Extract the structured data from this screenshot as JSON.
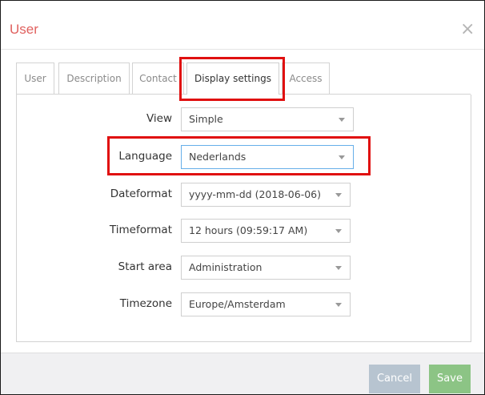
{
  "dialog": {
    "title": "User",
    "close_glyph": "×"
  },
  "tabs": [
    {
      "label": "User",
      "active": false
    },
    {
      "label": "Description",
      "active": false
    },
    {
      "label": "Contact",
      "active": false
    },
    {
      "label": "Display settings",
      "active": true
    },
    {
      "label": "Access",
      "active": false
    }
  ],
  "form": {
    "view": {
      "label": "View",
      "value": "Simple"
    },
    "language": {
      "label": "Language",
      "value": "Nederlands"
    },
    "dateformat": {
      "label": "Dateformat",
      "value": "yyyy-mm-dd (2018-06-06)"
    },
    "timeformat": {
      "label": "Timeformat",
      "value": "12 hours (09:59:17 AM)"
    },
    "start_area": {
      "label": "Start area",
      "value": "Administration"
    },
    "timezone": {
      "label": "Timezone",
      "value": "Europe/Amsterdam"
    }
  },
  "footer": {
    "cancel_label": "Cancel",
    "save_label": "Save"
  },
  "colors": {
    "title": "#e0615f",
    "highlight": "#e01010",
    "cancel_button": "#b7c4d0",
    "save_button": "#8cc485"
  },
  "icons": {
    "close": "close-icon",
    "dropdown": "chevron-down-icon"
  }
}
